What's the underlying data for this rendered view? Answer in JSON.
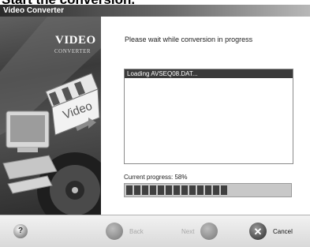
{
  "caption": "Start the conversion.",
  "window": {
    "title": "Video Converter"
  },
  "banner": {
    "title": "VIDEO",
    "subtitle": "CONVERTER",
    "clapper_text": "Video"
  },
  "content": {
    "wait_message": "Please wait while conversion in progress",
    "log_lines": [
      "Loading AVSEQ08.DAT..."
    ],
    "progress_label": "Current progress: 58%",
    "progress_fraction": 0.58
  },
  "footer": {
    "help_label": "?",
    "back_label": "Back",
    "next_label": "Next",
    "cancel_label": "Cancel",
    "cancel_glyph": "✕"
  },
  "icons": {
    "help": "help-icon",
    "back": "back-arrow-icon",
    "next": "next-arrow-icon",
    "cancel": "close-icon"
  }
}
